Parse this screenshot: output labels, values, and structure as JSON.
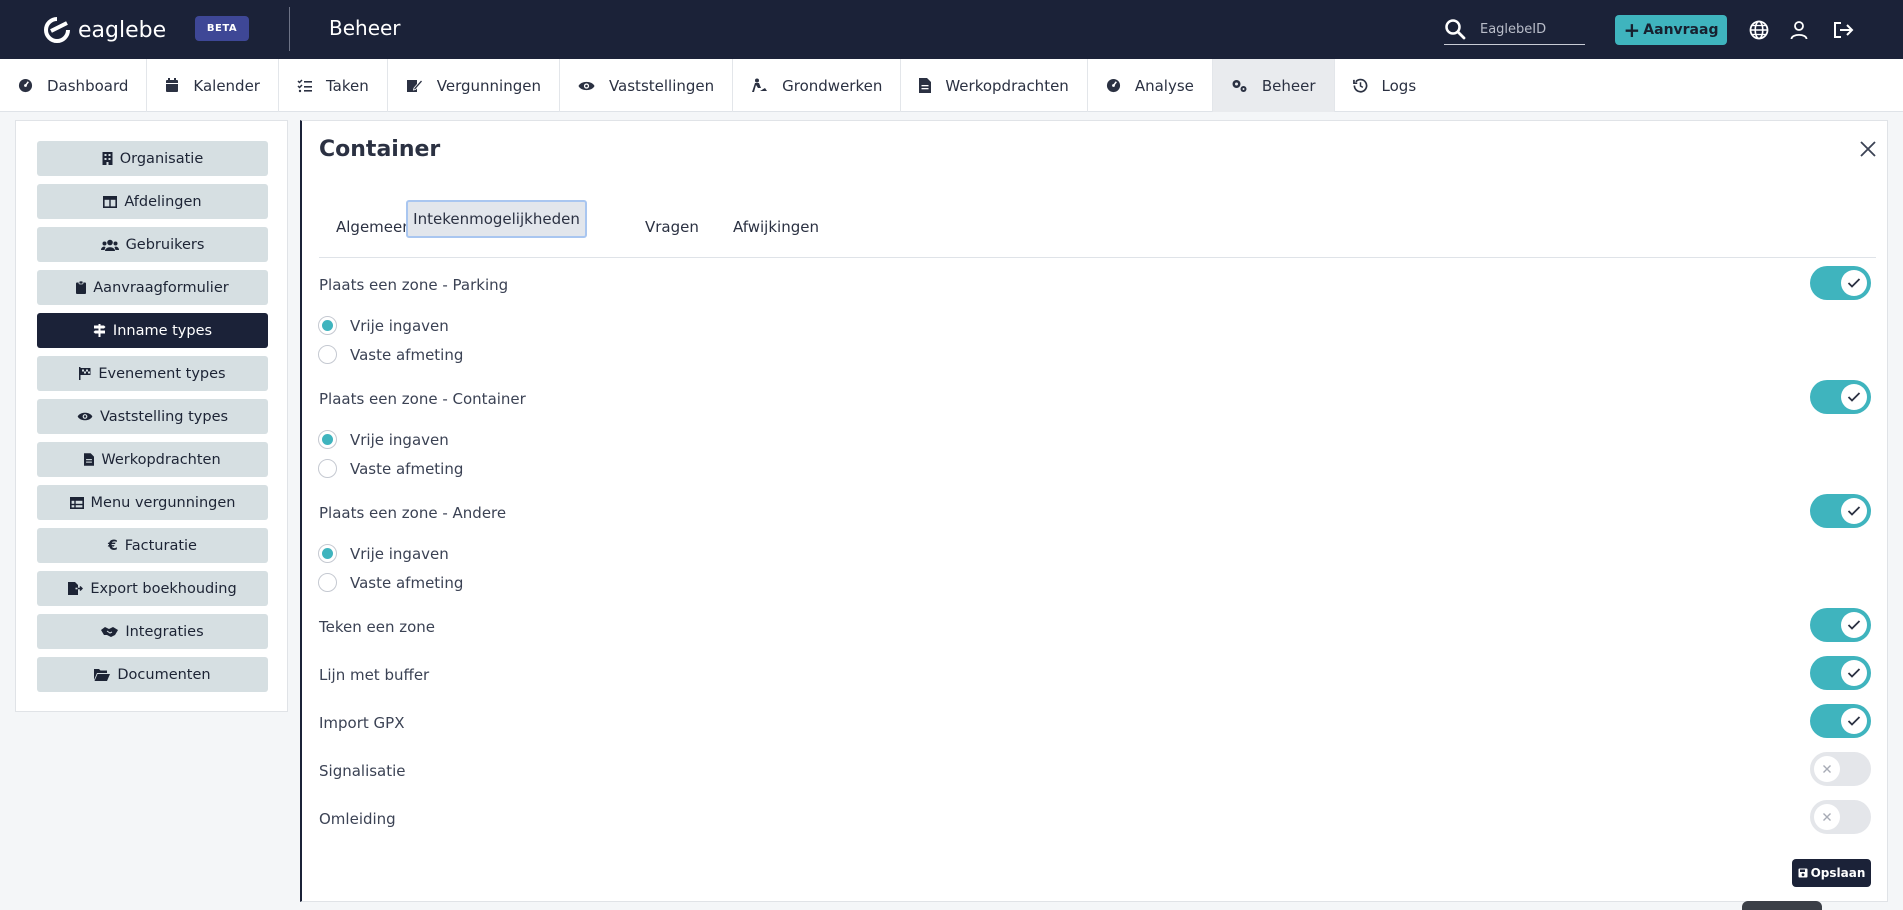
{
  "header": {
    "logo_text": "eaglebe",
    "beta_badge": "BETA",
    "app_title": "Beheer",
    "search_placeholder": "EaglebeID",
    "aanvraag_label": "Aanvraag"
  },
  "nav": {
    "items": [
      {
        "label": "Dashboard",
        "icon": "dashboard-icon"
      },
      {
        "label": "Kalender",
        "icon": "calendar-icon"
      },
      {
        "label": "Taken",
        "icon": "tasks-icon"
      },
      {
        "label": "Vergunningen",
        "icon": "permit-icon"
      },
      {
        "label": "Vaststellingen",
        "icon": "eye-icon"
      },
      {
        "label": "Grondwerken",
        "icon": "digging-icon"
      },
      {
        "label": "Werkopdrachten",
        "icon": "document-icon"
      },
      {
        "label": "Analyse",
        "icon": "dashboard-icon"
      },
      {
        "label": "Beheer",
        "icon": "cogs-icon"
      },
      {
        "label": "Logs",
        "icon": "history-icon"
      }
    ],
    "active": "Beheer"
  },
  "sidebar": {
    "items": [
      {
        "label": "Organisatie",
        "icon": "building-icon"
      },
      {
        "label": "Afdelingen",
        "icon": "table-icon"
      },
      {
        "label": "Gebruikers",
        "icon": "users-icon"
      },
      {
        "label": "Aanvraagformulier",
        "icon": "clipboard-icon"
      },
      {
        "label": "Inname types",
        "icon": "signs-icon"
      },
      {
        "label": "Evenement types",
        "icon": "flag-icon"
      },
      {
        "label": "Vaststelling types",
        "icon": "eye-icon"
      },
      {
        "label": "Werkopdrachten",
        "icon": "document-icon"
      },
      {
        "label": "Menu vergunningen",
        "icon": "table-icon"
      },
      {
        "label": "Facturatie",
        "icon": "euro-icon"
      },
      {
        "label": "Export boekhouding",
        "icon": "file-export-icon"
      },
      {
        "label": "Integraties",
        "icon": "handshake-icon"
      },
      {
        "label": "Documenten",
        "icon": "folder-open-icon"
      }
    ],
    "active": "Inname types"
  },
  "panel": {
    "title": "Container",
    "tabs": [
      "Algemeen",
      "Intekenmogelijkheden",
      "Vragen",
      "Afwijkingen"
    ],
    "active_tab": "Intekenmogelijkheden",
    "zones": [
      {
        "label": "Plaats een zone - Parking",
        "enabled": true,
        "options": [
          "Vrije ingaven",
          "Vaste afmeting"
        ],
        "selected": "Vrije ingaven"
      },
      {
        "label": "Plaats een zone - Container",
        "enabled": true,
        "options": [
          "Vrije ingaven",
          "Vaste afmeting"
        ],
        "selected": "Vrije ingaven"
      },
      {
        "label": "Plaats een zone - Andere",
        "enabled": true,
        "options": [
          "Vrije ingaven",
          "Vaste afmeting"
        ],
        "selected": "Vrije ingaven"
      }
    ],
    "toggles": [
      {
        "label": "Teken een zone",
        "enabled": true
      },
      {
        "label": "Lijn met buffer",
        "enabled": true
      },
      {
        "label": "Import GPX",
        "enabled": true
      },
      {
        "label": "Signalisatie",
        "enabled": false
      },
      {
        "label": "Omleiding",
        "enabled": false
      }
    ],
    "save_label": "Opslaan"
  },
  "colors": {
    "topbar": "#1b2238",
    "accent": "#3fb4be",
    "sidebar_button": "#d6dfe2"
  }
}
